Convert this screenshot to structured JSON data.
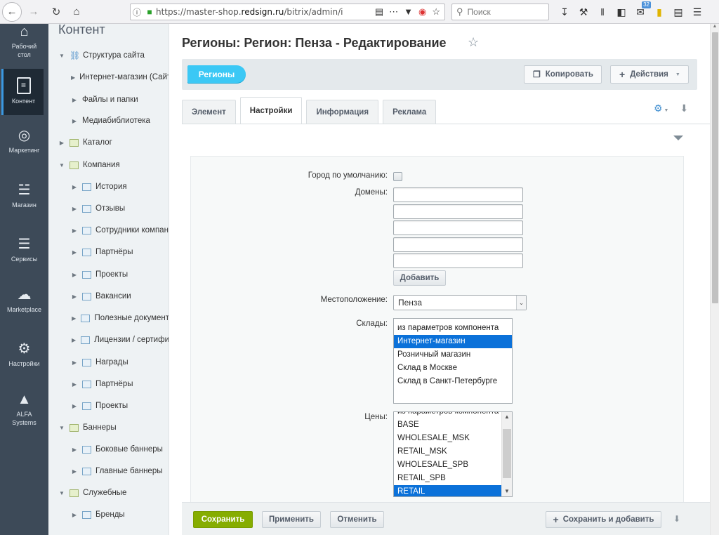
{
  "browser": {
    "url_prefix": "https://master-shop.",
    "url_domain": "redsign.ru",
    "url_path": "/bitrix/admin/i",
    "search_placeholder": "Поиск",
    "notifications_badge": "32"
  },
  "leftbar": {
    "items": [
      {
        "label_1": "Рабочий",
        "label_2": "стол",
        "icon": "house-icon"
      },
      {
        "label_1": "Контент",
        "label_2": "",
        "icon": "document-icon"
      },
      {
        "label_1": "Маркетинг",
        "label_2": "",
        "icon": "target-icon"
      },
      {
        "label_1": "Магазин",
        "label_2": "",
        "icon": "basket-icon"
      },
      {
        "label_1": "Сервисы",
        "label_2": "",
        "icon": "layers-icon"
      },
      {
        "label_1": "Marketplace",
        "label_2": "",
        "icon": "cloud-download-icon"
      },
      {
        "label_1": "Настройки",
        "label_2": "",
        "icon": "gear-icon"
      },
      {
        "label_1": "ALFA",
        "label_2": "Systems",
        "icon": "alfa-logo-icon"
      }
    ]
  },
  "tree": {
    "title": "Контент",
    "items": [
      {
        "label": "Структура сайта"
      },
      {
        "label": "Интернет-магазин (Сайт"
      },
      {
        "label": "Файлы и папки"
      },
      {
        "label": "Медиабиблиотека"
      },
      {
        "label": "Каталог"
      },
      {
        "label": "Компания"
      },
      {
        "label": "История"
      },
      {
        "label": "Отзывы"
      },
      {
        "label": "Сотрудники компан"
      },
      {
        "label": "Партнёры"
      },
      {
        "label": "Проекты"
      },
      {
        "label": "Вакансии"
      },
      {
        "label": "Полезные документ"
      },
      {
        "label": "Лицензии / сертифи"
      },
      {
        "label": "Награды"
      },
      {
        "label": "Партнёры"
      },
      {
        "label": "Проекты"
      },
      {
        "label": "Баннеры"
      },
      {
        "label": "Боковые баннеры"
      },
      {
        "label": "Главные баннеры"
      },
      {
        "label": "Служебные"
      },
      {
        "label": "Бренды"
      }
    ]
  },
  "page": {
    "title": "Регионы: Регион: Пенза - Редактирование"
  },
  "toolbar": {
    "regions_label": "Регионы",
    "copy_label": "Копировать",
    "actions_label": "Действия"
  },
  "tabs": [
    "Элемент",
    "Настройки",
    "Информация",
    "Реклама"
  ],
  "form": {
    "default_city_label": "Город по умолчанию:",
    "domains_label": "Домены:",
    "add_label": "Добавить",
    "location_label": "Местоположение:",
    "location_value": "Пенза",
    "stores_label": "Склады:",
    "stores_options": [
      "из параметров компонента",
      "Интернет-магазин",
      "Розничный магазин",
      "Склад в Москве",
      "Склад в Санкт-Петербурге"
    ],
    "stores_selected": "Интернет-магазин",
    "prices_label": "Цены:",
    "prices_partial": "из параметров компонента",
    "prices_options": [
      "BASE",
      "WHOLESALE_MSK",
      "RETAIL_MSK",
      "WHOLESALE_SPB",
      "RETAIL_SPB",
      "RETAIL"
    ],
    "prices_selected": "RETAIL"
  },
  "bottom": {
    "save_label": "Сохранить",
    "apply_label": "Применить",
    "cancel_label": "Отменить",
    "save_add_label": "Сохранить и добавить"
  },
  "colors": {
    "accent_blue": "#3bc8f5",
    "save_green": "#86ad00",
    "sidebar_dark": "#3d4a58",
    "selection_blue": "#0b71d9"
  }
}
